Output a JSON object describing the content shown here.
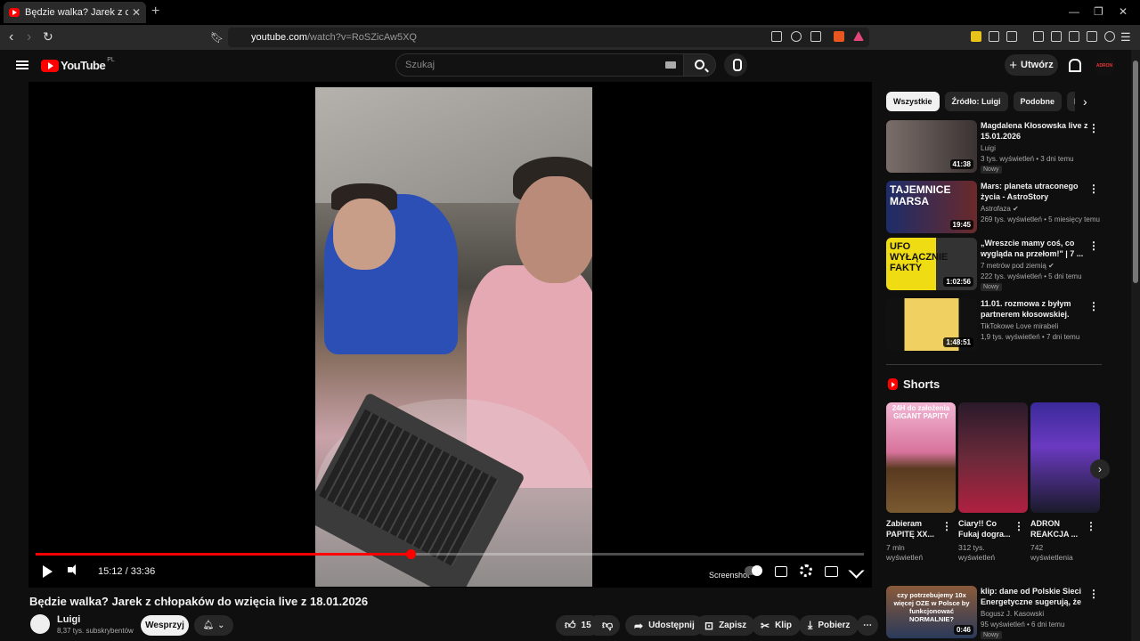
{
  "browser": {
    "tab_title": "Będzie walka? Jarek z chłopaków",
    "url_host": "youtube.com",
    "url_path": "/watch?v=RoSZicAw5XQ"
  },
  "header": {
    "logo_text": "YouTube",
    "country": "PL",
    "search_placeholder": "Szukaj",
    "create_label": "Utwórz",
    "avatar_text": "ADRON"
  },
  "player": {
    "time": "15:12 / 33:36",
    "progress_fraction": 0.4524,
    "screenshot_label": "Screenshot"
  },
  "video": {
    "title": "Będzie walka? Jarek z chłopaków do wzięcia live z 18.01.2026",
    "channel": "Luigi",
    "subscribers": "8,37 tys. subskrybentów",
    "support_label": "Wesprzyj",
    "likes": "15",
    "share_label": "Udostępnij",
    "save_label": "Zapisz",
    "clip_label": "Klip",
    "download_label": "Pobierz"
  },
  "chips": [
    "Wszystkie",
    "Źródło: Luigi",
    "Podobne",
    "Dla Ciebie"
  ],
  "recommendations": [
    {
      "title": "Magdalena Kłosowska live z 15.01.2026",
      "channel": "Luigi",
      "meta": "3 tys. wyświetleń • 3 dni temu",
      "badge": "Nowy",
      "duration": "41:38",
      "color": "#5a4d4a"
    },
    {
      "title": "Mars: planeta utraconego życia - AstroStory",
      "channel": "Astrofaza",
      "meta": "269 tys. wyświetleń • 5 miesięcy temu",
      "badge": "",
      "duration": "19:45",
      "color": "#2b3a6e",
      "thumb_text": "TAJEMNICE MARSA"
    },
    {
      "title": "„Wreszcie mamy coś, co wygląda na przełom!\" | 7 ...",
      "channel": "7 metrów pod ziemią",
      "meta": "222 tys. wyświetleń • 5 dni temu",
      "badge": "Nowy",
      "duration": "1:02:56",
      "color": "#e8d31a",
      "thumb_text": "UFO WYŁĄCZNIE FAKTY"
    },
    {
      "title": "11.01. rozmowa z byłym partnerem kłosowskiej.",
      "channel": "TikTokowe Love mirabeli",
      "meta": "1,9 tys. wyświetleń • 7 dni temu",
      "badge": "",
      "duration": "1:48:51",
      "color": "#1a1a1a"
    }
  ],
  "shorts": {
    "heading": "Shorts",
    "items": [
      {
        "title": "Zabieram PAPITĘ XX...",
        "views": "7 mln wyświetleń",
        "color": "#d88bb5",
        "thumb_text": "24H do założenia GIGANT PAPITY"
      },
      {
        "title": "Ciary!! Co Fukaj dogra...",
        "views": "312 tys. wyświetleń",
        "color": "#3a2030"
      },
      {
        "title": "ADRON REAKCJA ...",
        "views": "742 wyświetlenia",
        "color": "#2b3a8a"
      }
    ]
  },
  "bottom_rec": {
    "title": "klip: dane od Polskie Sieci Energetyczne sugerują, że zim...",
    "channel": "Bogusz J. Kasowski",
    "meta": "95 wyświetleń • 6 dni temu",
    "badge": "Nowy",
    "duration": "0:46",
    "thumb_text": "czy potrzebujemy 10x więcej OZE w Polsce by funkcjonować NORMALNIE?"
  }
}
